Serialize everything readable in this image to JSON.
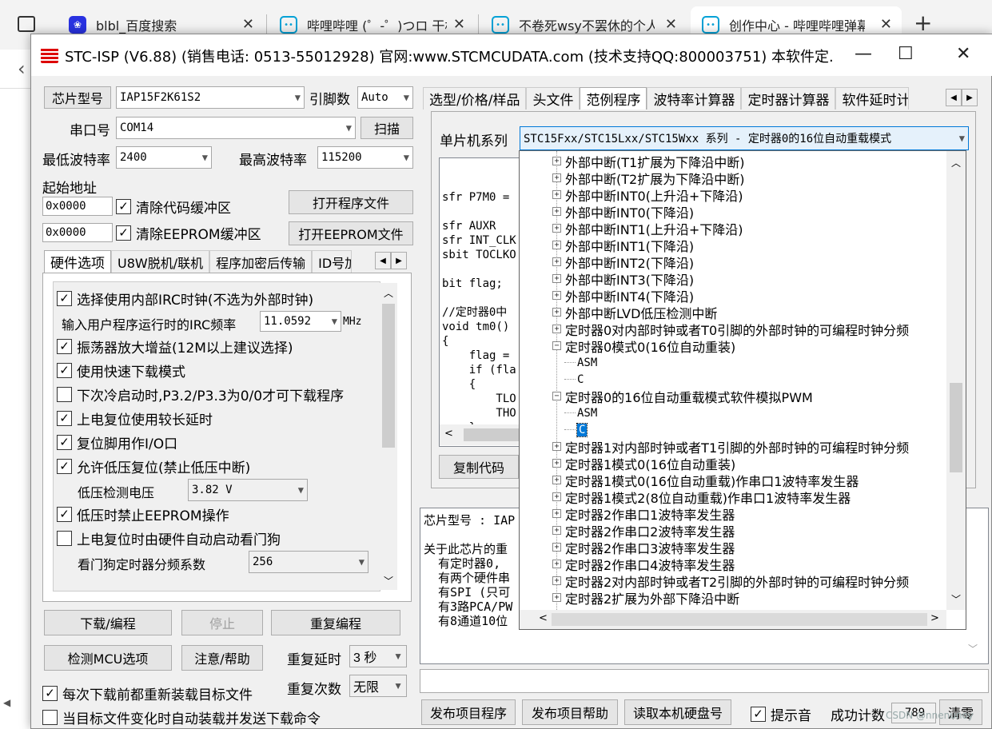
{
  "browser": {
    "tabs": [
      {
        "title": "blbl_百度搜索",
        "icon": "baidu-icon"
      },
      {
        "title": "哔哩哔哩 (゜-゜)つロ 干杯~-bilibili",
        "icon": "bilibili-icon"
      },
      {
        "title": "不卷死wsy不罢休的个人空间",
        "icon": "bilibili-icon"
      },
      {
        "title": "创作中心 - 哔哩哔哩弹幕视频网",
        "icon": "bilibili-icon"
      }
    ],
    "new_tab": "+"
  },
  "window": {
    "title": "STC-ISP (V6.88) (销售电话: 0513-55012928) 官网:www.STCMCUDATA.com  (技术支持QQ:800003751) 本软件定...",
    "min": "—",
    "max": "☐",
    "close": "✕"
  },
  "left": {
    "chip_btn": "芯片型号",
    "chip_value": "IAP15F2K61S2",
    "pin_label": "引脚数",
    "pin_value": "Auto",
    "port_label": "串口号",
    "port_value": "COM14",
    "scan_btn": "扫描",
    "min_baud_label": "最低波特率",
    "min_baud_value": "2400",
    "max_baud_label": "最高波特率",
    "max_baud_value": "115200",
    "start_addr_label": "起始地址",
    "addr1": "0x0000",
    "clear_code": "清除代码缓冲区",
    "open_prog": "打开程序文件",
    "addr2": "0x0000",
    "clear_eeprom": "清除EEPROM缓冲区",
    "open_eeprom": "打开EEPROM文件",
    "tabs": [
      "硬件选项",
      "U8W脱机/联机",
      "程序加密后传输",
      "ID号加"
    ],
    "options": {
      "opt1": "选择使用内部IRC时钟(不选为外部时钟)",
      "irc_label": "输入用户程序运行时的IRC频率",
      "irc_value": "11.0592",
      "irc_unit": "MHz",
      "opt2": "振荡器放大增益(12M以上建议选择)",
      "opt3": "使用快速下载模式",
      "opt4": "下次冷启动时,P3.2/P3.3为0/0才可下载程序",
      "opt5": "上电复位使用较长延时",
      "opt6": "复位脚用作I/O口",
      "opt7": "允许低压复位(禁止低压中断)",
      "lv_label": "低压检测电压",
      "lv_value": "3.82 V",
      "opt8": "低压时禁止EEPROM操作",
      "opt9": "上电复位时由硬件自动启动看门狗",
      "wdt_label": "看门狗定时器分频系数",
      "wdt_value": "256"
    },
    "download_btn": "下载/编程",
    "stop_btn": "停止",
    "reprog_btn": "重复编程",
    "detect_btn": "检测MCU选项",
    "help_btn": "注意/帮助",
    "repeat_delay_label": "重复延时",
    "repeat_delay_value": "3 秒",
    "repeat_count_label": "重复次数",
    "repeat_count_value": "无限",
    "reload_each": "每次下载前都重新装载目标文件",
    "auto_reload": "当目标文件变化时自动装载并发送下载命令"
  },
  "right": {
    "tabs": [
      "选型/价格/样品",
      "头文件",
      "范例程序",
      "波特率计算器",
      "定时器计算器",
      "软件延时计"
    ],
    "series_label": "单片机系列",
    "series_value": "STC15Fxx/STC15Lxx/STC15Wxx 系列 - 定时器0的16位自动重载模式",
    "code_lines": [
      "sfr P7M0 =",
      "",
      "sfr AUXR",
      "sfr INT_CLK",
      "sbit TOCLKO",
      "",
      "bit flag;",
      "",
      "//定时器0中",
      "void tm0()",
      "{",
      "    flag =",
      "    if (fla",
      "    {",
      "        TLO",
      "        THO",
      "    }",
      "    else",
      "    {"
    ],
    "copy_btn": "复制代码",
    "info_lines": [
      "芯片型号 : IAP",
      "",
      "关于此芯片的重",
      "  有定时器0,",
      "  有两个硬件串",
      "  有SPI (只可",
      "  有3路PCA/PW",
      "  有8通道10位"
    ],
    "publish_prog": "发布项目程序",
    "publish_help": "发布项目帮助",
    "read_disk": "读取本机硬盘号",
    "hint_sound": "提示音",
    "success_label": "成功计数",
    "success_value": "789",
    "clear_btn": "清零"
  },
  "tree": {
    "items": [
      {
        "label": "外部中断(T1扩展为下降沿中断)",
        "type": "node"
      },
      {
        "label": "外部中断(T2扩展为下降沿中断)",
        "type": "node"
      },
      {
        "label": "外部中断INT0(上升沿+下降沿)",
        "type": "node"
      },
      {
        "label": "外部中断INT0(下降沿)",
        "type": "node"
      },
      {
        "label": "外部中断INT1(上升沿+下降沿)",
        "type": "node"
      },
      {
        "label": "外部中断INT1(下降沿)",
        "type": "node"
      },
      {
        "label": "外部中断INT2(下降沿)",
        "type": "node"
      },
      {
        "label": "外部中断INT3(下降沿)",
        "type": "node"
      },
      {
        "label": "外部中断INT4(下降沿)",
        "type": "node"
      },
      {
        "label": "外部中断LVD低压检测中断",
        "type": "node"
      },
      {
        "label": "定时器0对内部时钟或者T0引脚的外部时钟的可编程时钟分频",
        "type": "node"
      },
      {
        "label": "定时器0模式0(16位自动重装)",
        "type": "open"
      },
      {
        "label": "ASM",
        "type": "leaf"
      },
      {
        "label": "C",
        "type": "leaf"
      },
      {
        "label": "定时器0的16位自动重载模式软件模拟PWM",
        "type": "open"
      },
      {
        "label": "ASM",
        "type": "leaf"
      },
      {
        "label": "C",
        "type": "leafsel"
      },
      {
        "label": "定时器1对内部时钟或者T1引脚的外部时钟的可编程时钟分频",
        "type": "node"
      },
      {
        "label": "定时器1模式0(16位自动重装)",
        "type": "node"
      },
      {
        "label": "定时器1模式0(16位自动重载)作串口1波特率发生器",
        "type": "node"
      },
      {
        "label": "定时器1模式2(8位自动重载)作串口1波特率发生器",
        "type": "node"
      },
      {
        "label": "定时器2作串口1波特率发生器",
        "type": "node"
      },
      {
        "label": "定时器2作串口2波特率发生器",
        "type": "node"
      },
      {
        "label": "定时器2作串口3波特率发生器",
        "type": "node"
      },
      {
        "label": "定时器2作串口4波特率发生器",
        "type": "node"
      },
      {
        "label": "定时器2对内部时钟或者T2引脚的外部时钟的可编程时钟分频",
        "type": "node"
      },
      {
        "label": "定时器2扩展为外部下降沿中断",
        "type": "node"
      }
    ]
  },
  "watermark": "CSDN @nnenunoy"
}
